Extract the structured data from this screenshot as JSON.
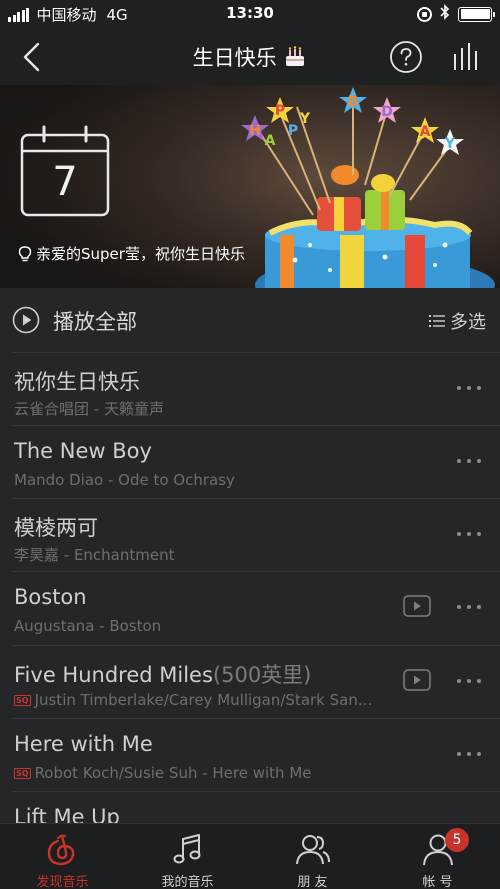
{
  "status_bar": {
    "carrier": "中国移动",
    "network": "4G",
    "time": "13:30"
  },
  "navbar": {
    "title": "生日快乐",
    "back_icon": "chevron-left-icon",
    "help_icon": "question-circle-icon",
    "player_icon": "equalizer-bars-icon"
  },
  "banner": {
    "day": "7",
    "greeting": "亲爱的Super莹，祝你生日快乐",
    "cake_letters": [
      "H",
      "A",
      "P",
      "P",
      "Y",
      "B",
      "D",
      "A",
      "Y"
    ]
  },
  "toolbar": {
    "play_all": "播放全部",
    "multi_select": "多选"
  },
  "songs": [
    {
      "title": "祝你生日快乐",
      "title_sub": "",
      "meta": "云雀合唱团 - 天籁童声",
      "sq": false,
      "mv": false
    },
    {
      "title": "The New Boy",
      "title_sub": "",
      "meta": "Mando Diao - Ode to Ochrasy",
      "sq": false,
      "mv": false
    },
    {
      "title": "模棱两可",
      "title_sub": "",
      "meta": "李昊嘉 - Enchantment",
      "sq": false,
      "mv": false
    },
    {
      "title": "Boston",
      "title_sub": "",
      "meta": "Augustana - Boston",
      "sq": false,
      "mv": true
    },
    {
      "title": "Five Hundred Miles",
      "title_sub": "(500英里)",
      "meta": "Justin Timberlake/Carey Mulligan/Stark San...",
      "sq": true,
      "mv": true
    },
    {
      "title": "Here with Me",
      "title_sub": "",
      "meta": "Robot Koch/Susie Suh - Here with Me",
      "sq": true,
      "mv": false
    },
    {
      "title": "Lift Me Up",
      "title_sub": "",
      "meta": "",
      "sq": false,
      "mv": false
    }
  ],
  "sq_badge": "SQ",
  "tabs": [
    {
      "label": "发现音乐",
      "icon": "netease-logo-icon",
      "active": true
    },
    {
      "label": "我的音乐",
      "icon": "music-note-icon",
      "active": false
    },
    {
      "label": "朋 友",
      "icon": "friends-icon",
      "active": false
    },
    {
      "label": "帐 号",
      "icon": "account-icon",
      "active": false
    }
  ],
  "account_badge": "5",
  "colors": {
    "accent": "#c8332b",
    "background": "#252629",
    "bar": "#1f2022"
  }
}
